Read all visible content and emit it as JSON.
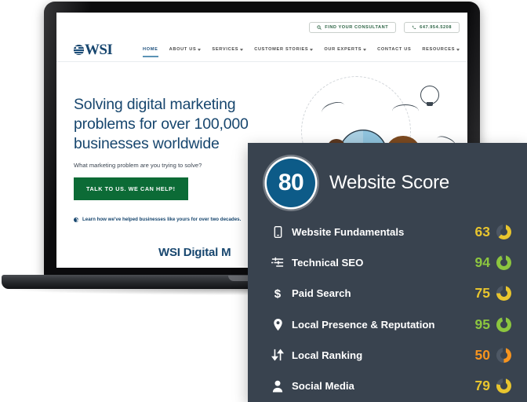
{
  "laptop": {
    "site": {
      "logo_text": "WSI",
      "logo_icon": "globe-icon",
      "top_buttons": [
        {
          "icon": "search-icon",
          "label": "FIND YOUR CONSULTANT"
        },
        {
          "icon": "phone-icon",
          "label": "647.954.5208"
        }
      ],
      "nav": [
        {
          "label": "HOME",
          "caret": false,
          "active": true
        },
        {
          "label": "ABOUT US",
          "caret": true,
          "active": false
        },
        {
          "label": "SERVICES",
          "caret": true,
          "active": false
        },
        {
          "label": "CUSTOMER STORIES",
          "caret": true,
          "active": false
        },
        {
          "label": "OUR EXPERTS",
          "caret": true,
          "active": false
        },
        {
          "label": "CONTACT US",
          "caret": false,
          "active": false
        },
        {
          "label": "RESOURCES",
          "caret": true,
          "active": false
        }
      ],
      "hero": {
        "headline": "Solving digital marketing problems for over 100,000 businesses worldwide",
        "subheadline": "What marketing problem are you trying to solve?",
        "cta_label": "TALK TO US. WE CAN HELP!",
        "learn_link": "Learn how we've helped businesses like yours for over two decades.",
        "footer_text": "WSI Digital M"
      }
    }
  },
  "panel": {
    "background": "#39434f",
    "overall_score": "80",
    "overall_badge_color": "#0d5b88",
    "title": "Website Score",
    "rows": [
      {
        "icon": "mobile-icon",
        "label": "Website Fundamentals",
        "value": "63",
        "color": "#e8c52e",
        "pct": 63
      },
      {
        "icon": "sliders-icon",
        "label": "Technical SEO",
        "value": "94",
        "color": "#8cc63f",
        "pct": 94
      },
      {
        "icon": "dollar-icon",
        "label": "Paid Search",
        "value": "75",
        "color": "#e8c52e",
        "pct": 75
      },
      {
        "icon": "map-pin-icon",
        "label": "Local Presence & Reputation",
        "value": "95",
        "color": "#8cc63f",
        "pct": 95
      },
      {
        "icon": "updown-arrows-icon",
        "label": "Local Ranking",
        "value": "50",
        "color": "#f7941e",
        "pct": 50
      },
      {
        "icon": "person-icon",
        "label": "Social Media",
        "value": "79",
        "color": "#e8c52e",
        "pct": 79
      }
    ]
  }
}
